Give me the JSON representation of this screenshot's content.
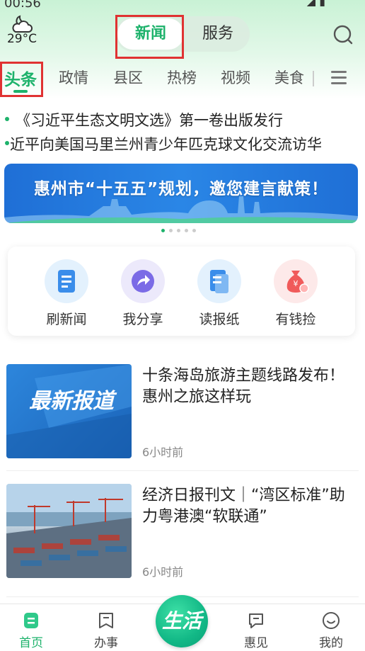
{
  "status": {
    "time": "00:56"
  },
  "weather": {
    "temp": "29°C",
    "icon": "cloudy-night-icon"
  },
  "segment": {
    "news": "新闻",
    "service": "服务"
  },
  "tabs": [
    "头条",
    "政情",
    "县区",
    "热榜",
    "视频",
    "美食"
  ],
  "ticker": [
    "《习近平生态文明文选》第一卷出版发行",
    "近平向美国马里兰州青少年匹克球文化交流访华"
  ],
  "banner": {
    "title": "惠州市“十五五”规划，邀您建言献策！"
  },
  "carousel": {
    "total": 5,
    "active": 0
  },
  "quick_actions": [
    {
      "label": "刷新闻",
      "icon": "news-doc-icon",
      "color": "#3a8dea",
      "bg": "#e3f1fd"
    },
    {
      "label": "我分享",
      "icon": "share-arrow-icon",
      "color": "#7b6be6",
      "bg": "#ece9fb"
    },
    {
      "label": "读报纸",
      "icon": "newspaper-icon",
      "color": "#3a8dea",
      "bg": "#e3f1fd"
    },
    {
      "label": "有钱捡",
      "icon": "money-bag-icon",
      "color": "#f05a5a",
      "bg": "#fde9e9"
    }
  ],
  "articles": [
    {
      "title": "十条海岛旅游主题线路发布！惠州之旅这样玩",
      "time": "6小时前",
      "thumb_text": "最新报道"
    },
    {
      "title": "经济日报刊文｜“湾区标准”助力粤港澳“软联通”",
      "time": "6小时前"
    }
  ],
  "bottom_nav": {
    "home": "首页",
    "affairs": "办事",
    "center": "生活",
    "huijian": "惠见",
    "mine": "我的"
  },
  "colors": {
    "accent": "#1db26b",
    "highlight": "#e03232"
  }
}
